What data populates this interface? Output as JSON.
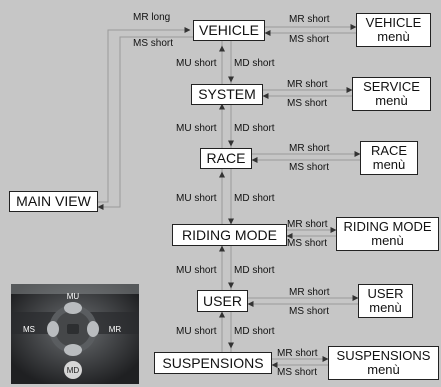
{
  "colors": {
    "background": "#c6c6c6",
    "box_fill": "#ffffff",
    "box_border": "#222222",
    "line": "#9a9a9a",
    "arrow": "#333333"
  },
  "boxes": {
    "main_view": "MAIN VIEW",
    "vehicle": "VEHICLE",
    "system": "SYSTEM",
    "race": "RACE",
    "riding_mode": "RIDING MODE",
    "user": "USER",
    "suspensions": "SUSPENSIONS"
  },
  "menus": {
    "vehicle": {
      "line1": "VEHICLE",
      "line2": "menù"
    },
    "service": {
      "line1": "SERVICE",
      "line2": "menù"
    },
    "race": {
      "line1": "RACE",
      "line2": "menù"
    },
    "riding_mode": {
      "line1": "RIDING MODE",
      "line2": "menù"
    },
    "user": {
      "line1": "USER",
      "line2": "menù"
    },
    "suspensions": {
      "line1": "SUSPENSIONS",
      "line2": "menù"
    }
  },
  "labels": {
    "mr_long": "MR long",
    "ms_short_main": "MS short",
    "mr_short": "MR short",
    "ms_short": "MS short",
    "mu_short": "MU short",
    "md_short": "MD short"
  },
  "controller": {
    "mu": "MU",
    "ms": "MS",
    "mr": "MR",
    "md": "MD"
  }
}
